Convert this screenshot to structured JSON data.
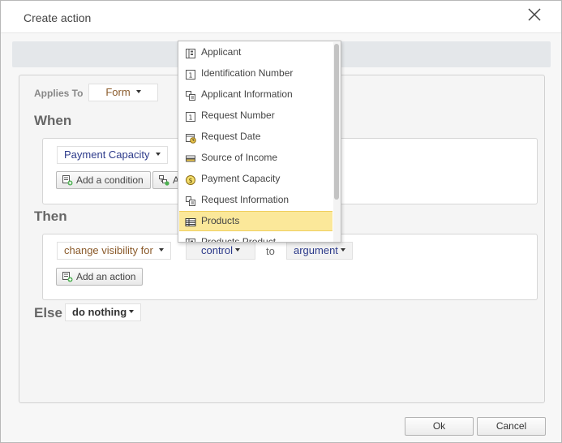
{
  "dialog": {
    "title": "Create action"
  },
  "applies_to": {
    "label": "Applies To",
    "value": "Form"
  },
  "when": {
    "title": "When",
    "condition_value": "Payment Capacity",
    "add_condition_label": "Add a condition",
    "second_button_label": "A"
  },
  "then": {
    "title": "Then",
    "action_value": "change visibility for",
    "control_value": "control",
    "to_label": "to",
    "argument_value": "argument",
    "add_action_label": "Add an action"
  },
  "else": {
    "title": "Else",
    "value": "do nothing"
  },
  "footer": {
    "ok_label": "Ok",
    "cancel_label": "Cancel"
  },
  "menu": {
    "items": [
      {
        "label": "Applicant",
        "icon": "form-icon"
      },
      {
        "label": "Identification Number",
        "icon": "number-field-icon"
      },
      {
        "label": "Applicant Information",
        "icon": "group-icon"
      },
      {
        "label": "Request Number",
        "icon": "number-field-icon"
      },
      {
        "label": "Request Date",
        "icon": "date-field-icon"
      },
      {
        "label": "Source of Income",
        "icon": "list-field-icon"
      },
      {
        "label": "Payment Capacity",
        "icon": "currency-field-icon"
      },
      {
        "label": "Request Information",
        "icon": "group-icon"
      },
      {
        "label": "Products",
        "icon": "grid-icon"
      },
      {
        "label": "Products Product",
        "icon": "form-icon"
      }
    ],
    "selected": "Products"
  },
  "colors": {
    "selected_bg": "#fbe89a",
    "brown_text": "#8a5a2a",
    "navy_text": "#2c3a8a"
  }
}
